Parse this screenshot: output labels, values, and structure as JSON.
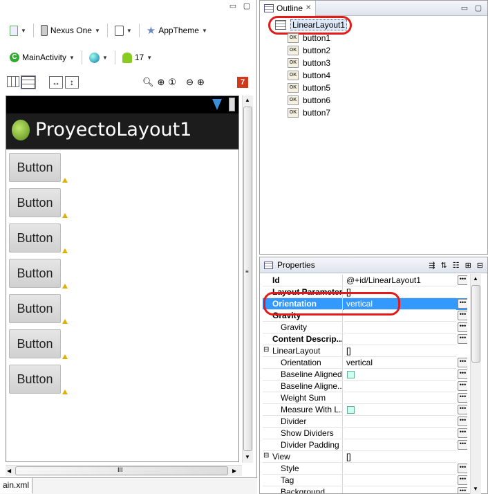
{
  "editor": {
    "toolbar1": {
      "device": "Nexus One",
      "theme": "AppTheme"
    },
    "toolbar2": {
      "activity": "MainActivity",
      "api_level": "17"
    },
    "error_badge": "7",
    "app_title": "ProyectoLayout1",
    "buttons": [
      "Button",
      "Button",
      "Button",
      "Button",
      "Button",
      "Button",
      "Button"
    ],
    "hscroll_label": "III",
    "bottom_tab": "ain.xml"
  },
  "outline": {
    "tab_label": "Outline",
    "root": "LinearLayout1",
    "children": [
      "button1",
      "button2",
      "button3",
      "button4",
      "button5",
      "button6",
      "button7"
    ]
  },
  "properties": {
    "tab_label": "Properties",
    "rows": [
      {
        "name": "Id",
        "value": "@+id/LinearLayout1",
        "bold": true
      },
      {
        "name": "Layout Parameters",
        "value": "[]",
        "bold": true
      },
      {
        "name": "Orientation",
        "value": "vertical",
        "bold": true,
        "selected": true
      },
      {
        "name": "Gravity",
        "value": "",
        "bold": true
      },
      {
        "name": "Gravity",
        "value": "",
        "bold": false
      },
      {
        "name": "Content Descrip...",
        "value": "",
        "bold": true
      },
      {
        "name": "LinearLayout",
        "value": "[]",
        "bold": false,
        "group": true
      },
      {
        "name": "Orientation",
        "value": "vertical",
        "bold": false
      },
      {
        "name": "Baseline Aligned",
        "value": "",
        "bold": false,
        "check": true
      },
      {
        "name": "Baseline Aligne...",
        "value": "",
        "bold": false
      },
      {
        "name": "Weight Sum",
        "value": "",
        "bold": false
      },
      {
        "name": "Measure With L...",
        "value": "",
        "bold": false,
        "check": true
      },
      {
        "name": "Divider",
        "value": "",
        "bold": false
      },
      {
        "name": "Show Dividers",
        "value": "",
        "bold": false
      },
      {
        "name": "Divider Padding",
        "value": "",
        "bold": false
      },
      {
        "name": "View",
        "value": "[]",
        "bold": false,
        "group": true
      },
      {
        "name": "Style",
        "value": "",
        "bold": false
      },
      {
        "name": "Tag",
        "value": "",
        "bold": false
      },
      {
        "name": "Background",
        "value": "",
        "bold": false
      }
    ]
  }
}
